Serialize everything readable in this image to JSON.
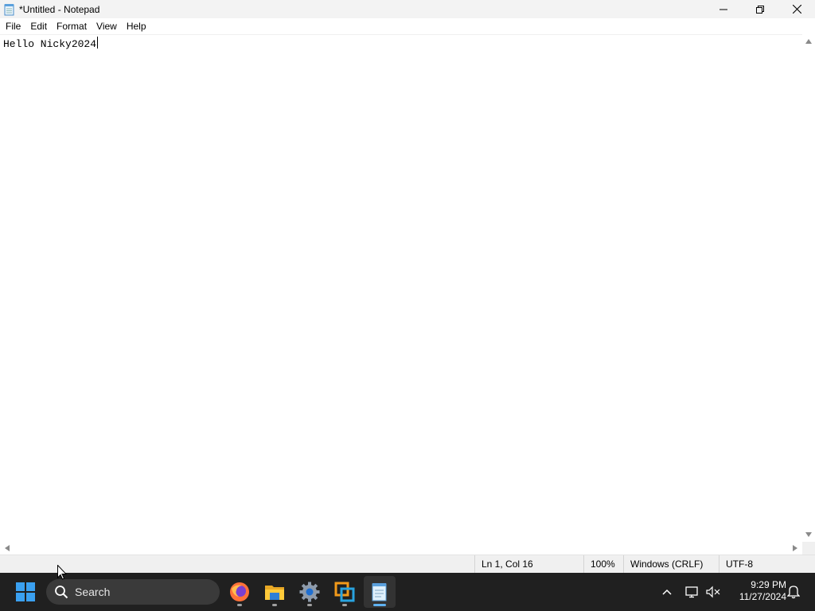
{
  "window": {
    "title": "*Untitled - Notepad",
    "icon": "notepad-icon",
    "controls": [
      "minimize-icon",
      "restore-icon",
      "close-icon"
    ]
  },
  "menu": {
    "items": [
      {
        "label": "File"
      },
      {
        "label": "Edit"
      },
      {
        "label": "Format"
      },
      {
        "label": "View"
      },
      {
        "label": "Help"
      }
    ]
  },
  "editor": {
    "content": "Hello Nicky2024"
  },
  "status": {
    "position": "Ln 1, Col 16",
    "zoom": "100%",
    "line_ending": "Windows (CRLF)",
    "encoding": "UTF-8"
  },
  "taskbar": {
    "search_label": "Search",
    "apps": [
      {
        "name": "firefox-icon"
      },
      {
        "name": "file-explorer-icon"
      },
      {
        "name": "settings-icon"
      },
      {
        "name": "remote-app-icon"
      },
      {
        "name": "notepad-icon"
      }
    ],
    "tray_icons": [
      "chevron-up-icon",
      "network-icon",
      "volume-muted-icon",
      "notification-bell-icon"
    ],
    "time": "9:29 PM",
    "date": "11/27/2024"
  },
  "colors": {
    "taskbar_bg": "#202020",
    "accent": "#0078d4",
    "titlebar_bg": "#f3f3f3",
    "statusbar_bg": "#f0f0f0"
  }
}
